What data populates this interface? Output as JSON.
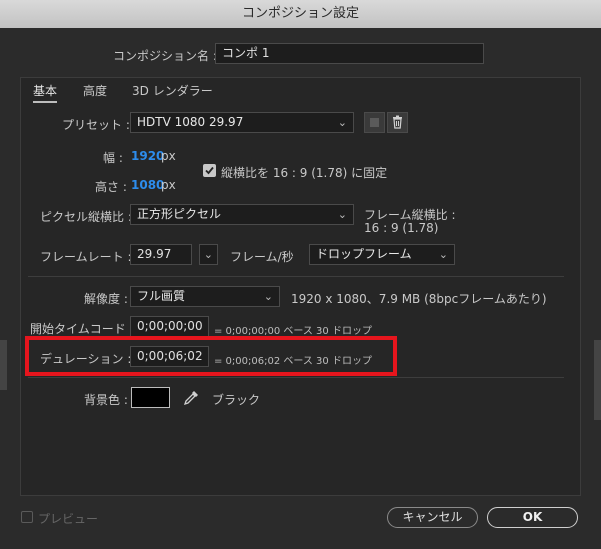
{
  "window": {
    "title": "コンポジション設定"
  },
  "comp_name": {
    "label": "コンポジション名 :",
    "value": "コンポ 1"
  },
  "tabs": [
    {
      "label": "基本",
      "active": true
    },
    {
      "label": "高度",
      "active": false
    },
    {
      "label": "3D レンダラー",
      "active": false
    }
  ],
  "preset": {
    "label": "プリセット :",
    "value": "HDTV 1080 29.97"
  },
  "width": {
    "label": "幅 :",
    "value": "1920",
    "unit": "px"
  },
  "height": {
    "label": "高さ :",
    "value": "1080",
    "unit": "px"
  },
  "aspect_lock": {
    "label": "縦横比を 16 : 9 (1.78) に固定",
    "checked": true
  },
  "pixel_aspect": {
    "label": "ピクセル縦横比 :",
    "value": "正方形ピクセル",
    "frame_aspect_label": "フレーム縦横比 :",
    "frame_aspect_value": "16 : 9 (1.78)"
  },
  "frame_rate": {
    "label": "フレームレート :",
    "value": "29.97",
    "unit": "フレーム/秒",
    "mode": "ドロップフレーム"
  },
  "resolution": {
    "label": "解像度 :",
    "value": "フル画質",
    "info": "1920 x 1080、7.9 MB (8bpcフレームあたり)"
  },
  "start_timecode": {
    "label": "開始タイムコード :",
    "value": "0;00;00;00",
    "info": "= 0;00;00;00  ベース 30  ドロップ"
  },
  "duration": {
    "label": "デュレーション :",
    "value": "0;00;06;02",
    "info": "= 0;00;06;02  ベース 30  ドロップ"
  },
  "background": {
    "label": "背景色 :",
    "color": "#000000",
    "name": "ブラック"
  },
  "footer": {
    "preview_label": "プレビュー",
    "cancel_label": "キャンセル",
    "ok_label": "OK"
  },
  "colors": {
    "highlight": "#e6151d",
    "value_blue": "#2d8ceb"
  }
}
